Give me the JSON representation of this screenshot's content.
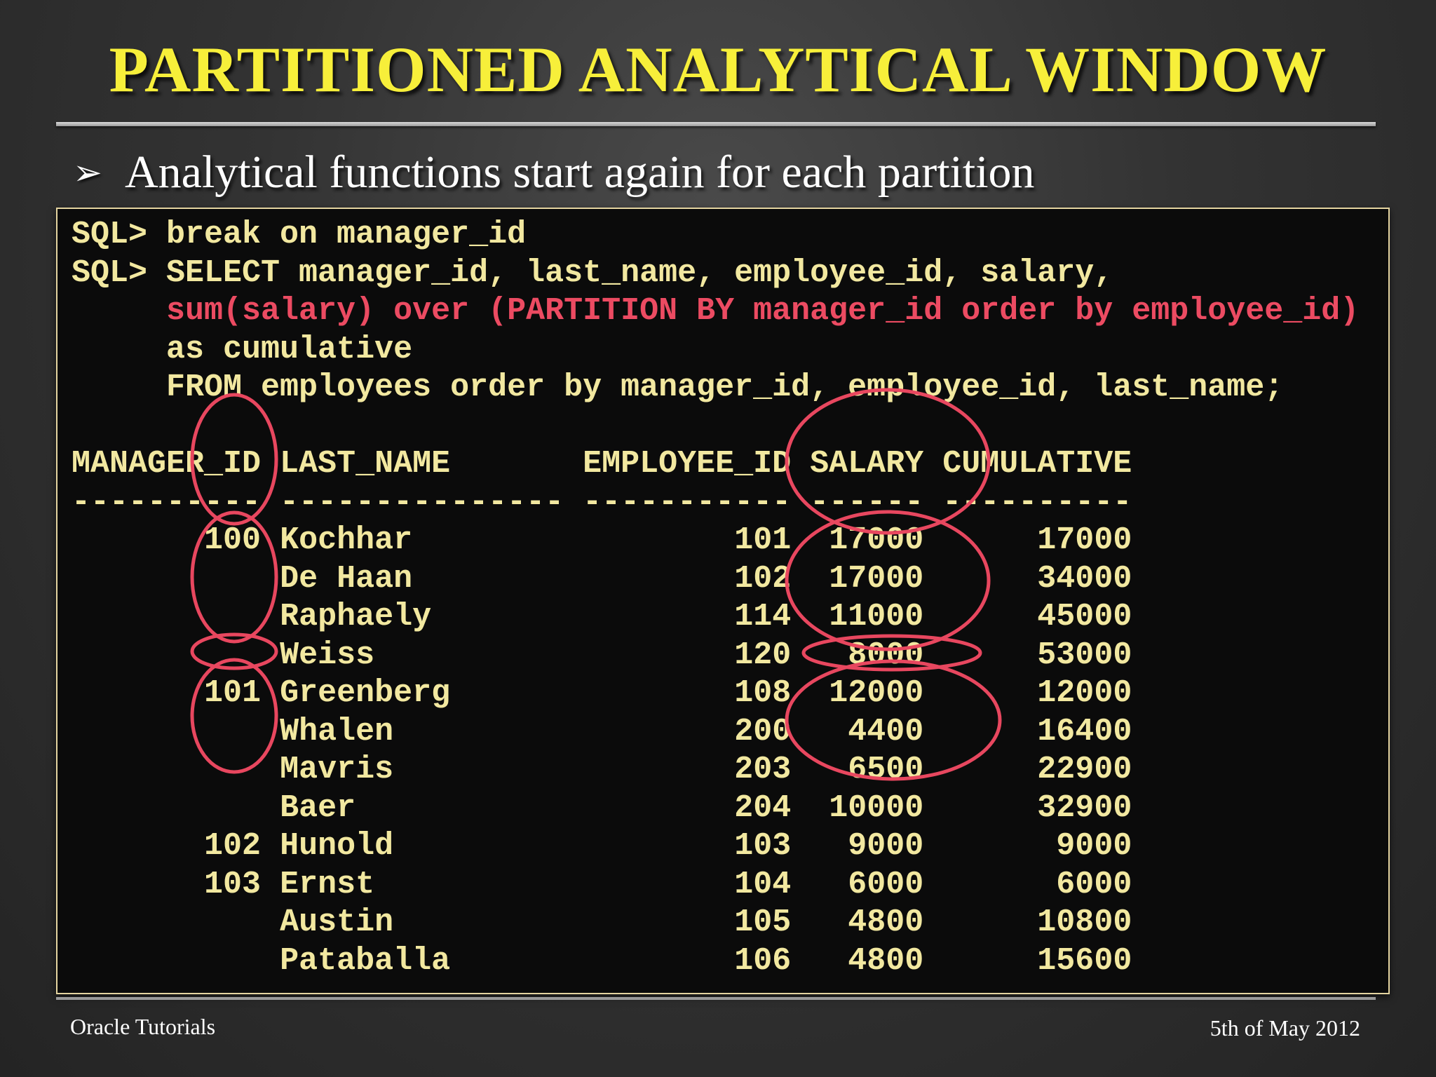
{
  "slide": {
    "title": "PARTITIONED ANALYTICAL WINDOW",
    "bullet_icon": "arrowhead-bullet",
    "bullet": "Analytical functions start again for each partition"
  },
  "sql": {
    "line1": "SQL> break on manager_id",
    "line2": "SQL> SELECT manager_id, last_name, employee_id, salary,",
    "line3": "     sum(salary) over (PARTITION BY manager_id order by employee_id)",
    "line4": "     as cumulative",
    "line5": "     FROM employees order by manager_id, employee_id, last_name;"
  },
  "result": {
    "header": "MANAGER_ID LAST_NAME       EMPLOYEE_ID SALARY CUMULATIVE",
    "separator": "---------- --------------- ----------- ------ ----------",
    "columns": [
      "MANAGER_ID",
      "LAST_NAME",
      "EMPLOYEE_ID",
      "SALARY",
      "CUMULATIVE"
    ],
    "rows": [
      {
        "manager_id": "100",
        "last_name": "Kochhar",
        "employee_id": "101",
        "salary": "17000",
        "cumulative": "17000"
      },
      {
        "manager_id": "",
        "last_name": "De Haan",
        "employee_id": "102",
        "salary": "17000",
        "cumulative": "34000"
      },
      {
        "manager_id": "",
        "last_name": "Raphaely",
        "employee_id": "114",
        "salary": "11000",
        "cumulative": "45000"
      },
      {
        "manager_id": "",
        "last_name": "Weiss",
        "employee_id": "120",
        "salary": "8000",
        "cumulative": "53000"
      },
      {
        "manager_id": "101",
        "last_name": "Greenberg",
        "employee_id": "108",
        "salary": "12000",
        "cumulative": "12000"
      },
      {
        "manager_id": "",
        "last_name": "Whalen",
        "employee_id": "200",
        "salary": "4400",
        "cumulative": "16400"
      },
      {
        "manager_id": "",
        "last_name": "Mavris",
        "employee_id": "203",
        "salary": "6500",
        "cumulative": "22900"
      },
      {
        "manager_id": "",
        "last_name": "Baer",
        "employee_id": "204",
        "salary": "10000",
        "cumulative": "32900"
      },
      {
        "manager_id": "102",
        "last_name": "Hunold",
        "employee_id": "103",
        "salary": "9000",
        "cumulative": "9000"
      },
      {
        "manager_id": "103",
        "last_name": "Ernst",
        "employee_id": "104",
        "salary": "6000",
        "cumulative": "6000"
      },
      {
        "manager_id": "",
        "last_name": "Austin",
        "employee_id": "105",
        "salary": "4800",
        "cumulative": "10800"
      },
      {
        "manager_id": "",
        "last_name": "Pataballa",
        "employee_id": "106",
        "salary": "4800",
        "cumulative": "15600"
      }
    ]
  },
  "annotation_color": "#e8475f",
  "footer": {
    "left": "Oracle Tutorials",
    "right": "5th of May 2012"
  }
}
